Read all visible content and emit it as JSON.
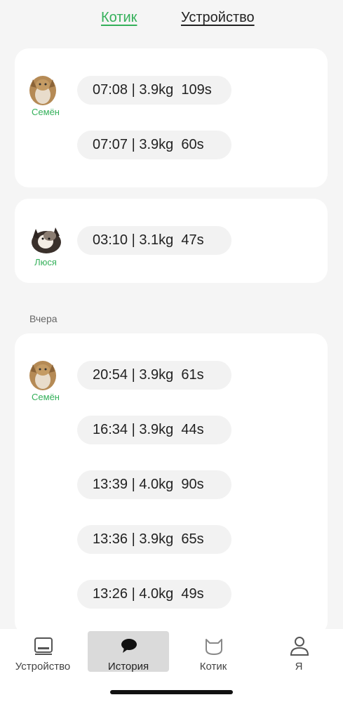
{
  "top_tabs": {
    "cat": "Котик",
    "device": "Устройство"
  },
  "colors": {
    "accent": "#34b05a",
    "background": "#f5f5f5",
    "card": "#ffffff",
    "pill": "#f2f2f2"
  },
  "groups": [
    {
      "cat_name": "Семён",
      "records": [
        "07:08 | 3.9kg  109s",
        "07:07 | 3.9kg  60s"
      ]
    },
    {
      "cat_name": "Люся",
      "records": [
        "03:10 | 3.1kg  47s"
      ]
    }
  ],
  "yesterday": {
    "label": "Вчера",
    "groups": [
      {
        "cat_name": "Семён",
        "records": [
          "20:54 | 3.9kg  61s",
          "16:34 | 3.9kg  44s",
          "13:39 | 4.0kg  90s",
          "13:36 | 3.9kg  65s",
          "13:26 | 4.0kg  49s"
        ]
      }
    ]
  },
  "bottom_nav": [
    {
      "label": "Устройство",
      "icon": "device-icon"
    },
    {
      "label": "История",
      "icon": "chat-bubble-icon",
      "active": true
    },
    {
      "label": "Котик",
      "icon": "cat-icon"
    },
    {
      "label": "Я",
      "icon": "person-icon"
    }
  ]
}
